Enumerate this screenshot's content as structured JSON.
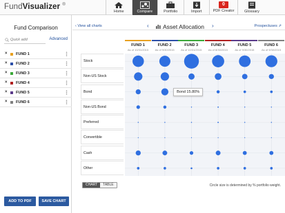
{
  "brand": {
    "name_light": "Fund",
    "name_bold": "Visualizer",
    "mark": "®"
  },
  "nav": [
    {
      "label": "Home",
      "icon": "home-icon",
      "active": false
    },
    {
      "label": "Compare",
      "icon": "compare-icon",
      "active": true
    },
    {
      "label": "Portfolio",
      "icon": "briefcase-icon",
      "active": false
    },
    {
      "label": "Import",
      "icon": "import-icon",
      "active": false
    },
    {
      "label": "PDF Creator",
      "icon": "pdf-icon",
      "badge": "0",
      "active": false
    },
    {
      "label": "Glossary",
      "icon": "book-icon",
      "active": false
    }
  ],
  "sidebar": {
    "title": "Fund Comparison",
    "quick_add_placeholder": "Quick add",
    "advanced_label": "Advanced",
    "funds": [
      {
        "name": "FUND 1",
        "color": "#e8a020"
      },
      {
        "name": "FUND 2",
        "color": "#2c4fa8"
      },
      {
        "name": "FUND 3",
        "color": "#3aa838"
      },
      {
        "name": "FUND 4",
        "color": "#b02020"
      },
      {
        "name": "FUND 5",
        "color": "#5a3a8a"
      },
      {
        "name": "FUND 6",
        "color": "#808080"
      }
    ],
    "add_to_pdf_label": "ADD TO PDF",
    "save_chart_label": "SAVE CHART"
  },
  "main": {
    "view_all_label": "View all charts",
    "title": "Asset Allocation",
    "prospectuses_label": "Prospectuses",
    "toggle": {
      "chart_label": "CHART",
      "table_label": "TABLE",
      "active": "chart"
    },
    "note": "Circle size is determined by % portfolio weight.",
    "tooltip": "Bond 15.80%",
    "funds": [
      {
        "label": "FUND 1",
        "date": "As of 10/31/2015",
        "color": "#e8a020"
      },
      {
        "label": "FUND 2",
        "date": "As of 9/30/2015",
        "color": "#2c4fa8"
      },
      {
        "label": "FUND 3",
        "date": "As of 10/31/2015",
        "color": "#3aa838"
      },
      {
        "label": "FUND 4",
        "date": "As of 8/30/2015",
        "color": "#b02020"
      },
      {
        "label": "FUND 5",
        "date": "As of 9/30/2015",
        "color": "#5a3a8a"
      },
      {
        "label": "FUND 6",
        "date": "As of 9/30/2015",
        "color": "#808080"
      }
    ]
  },
  "chart_data": {
    "type": "bubble-matrix",
    "title": "Asset Allocation",
    "categories": [
      "Stock",
      "Non-US Stock",
      "Bond",
      "Non-US Bond",
      "Preferred",
      "Convertible",
      "Cash",
      "Other"
    ],
    "size_encoding": "% portfolio weight",
    "bubble_color": "#2f6fe0",
    "series": [
      {
        "name": "FUND 1",
        "values": [
          40,
          22,
          8,
          4,
          0.3,
          0.2,
          8,
          2
        ]
      },
      {
        "name": "FUND 2",
        "values": [
          38,
          22,
          15.8,
          3,
          0.3,
          0.2,
          7,
          2
        ]
      },
      {
        "name": "FUND 3",
        "values": [
          68,
          12,
          1,
          0.3,
          0.3,
          0.2,
          4,
          1
        ]
      },
      {
        "name": "FUND 4",
        "values": [
          46,
          14,
          3,
          0.5,
          0.5,
          0.2,
          7,
          2
        ]
      },
      {
        "name": "FUND 5",
        "values": [
          42,
          9,
          2,
          0.3,
          0.3,
          0.2,
          5,
          2
        ]
      },
      {
        "name": "FUND 6",
        "values": [
          44,
          8,
          2,
          0.3,
          0.3,
          0.2,
          5,
          2
        ]
      }
    ]
  }
}
